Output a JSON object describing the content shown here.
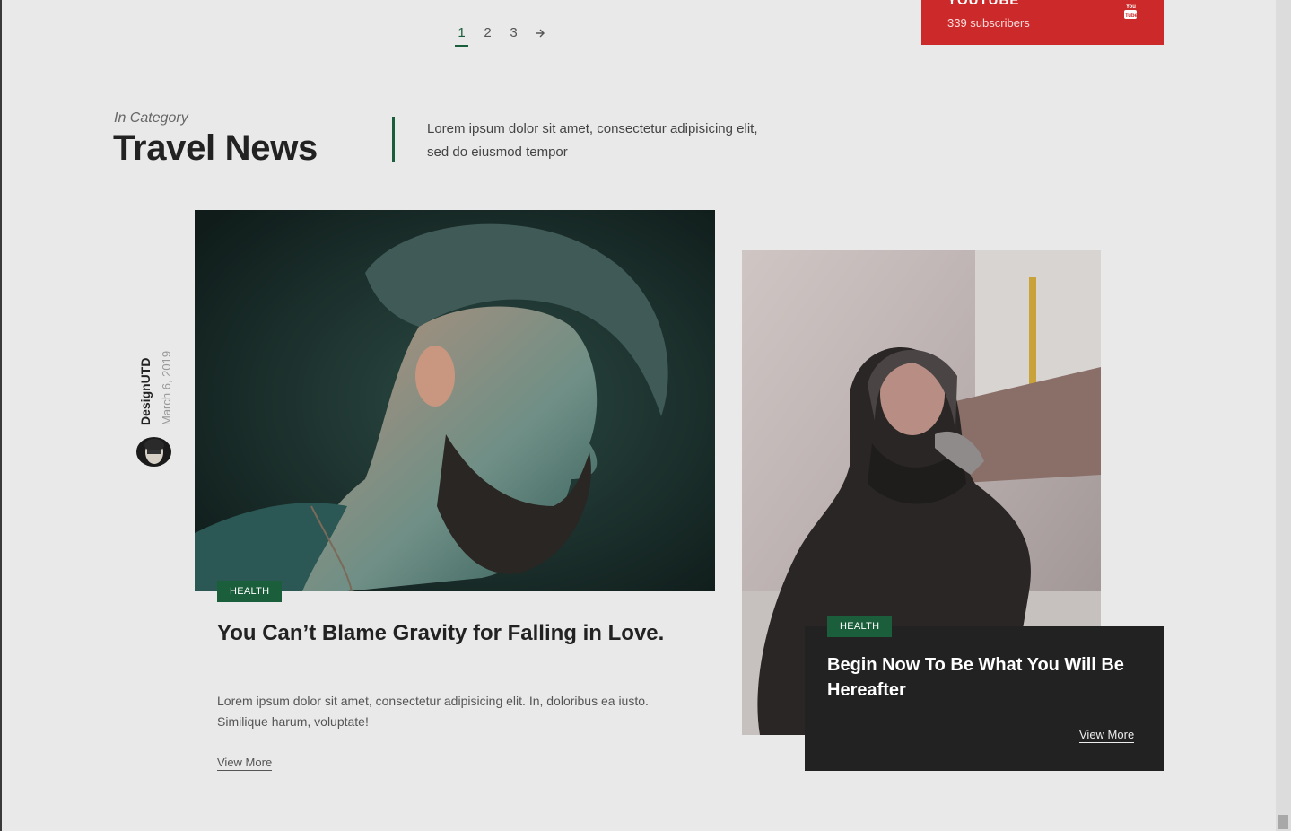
{
  "pagination": {
    "pages": [
      "1",
      "2",
      "3"
    ],
    "active_page": "1",
    "next_icon": "arrow-right-icon"
  },
  "youtube_widget": {
    "name": "YOUTUBE",
    "subscribers": "339 subscribers",
    "icon": "youtube-icon",
    "color": "#cc2a2a"
  },
  "section": {
    "kicker": "In Category",
    "title": "Travel News",
    "description": "Lorem ipsum dolor sit amet, consectetur adipisicing elit, sed do eiusmod tempor",
    "accent": "#1b5e3b"
  },
  "featured_post": {
    "author": "DesignUTD",
    "date": "March 6, 2019",
    "category": "HEALTH",
    "title": "You Can’t Blame Gravity for Falling in Love.",
    "excerpt": "Lorem ipsum dolor sit amet, consectetur adipisicing elit. In, doloribus ea iusto. Similique harum, voluptate!",
    "view_more": "View More"
  },
  "side_post": {
    "category": "HEALTH",
    "title": "Begin Now To Be What You Will Be Hereafter",
    "view_more": "View More"
  }
}
